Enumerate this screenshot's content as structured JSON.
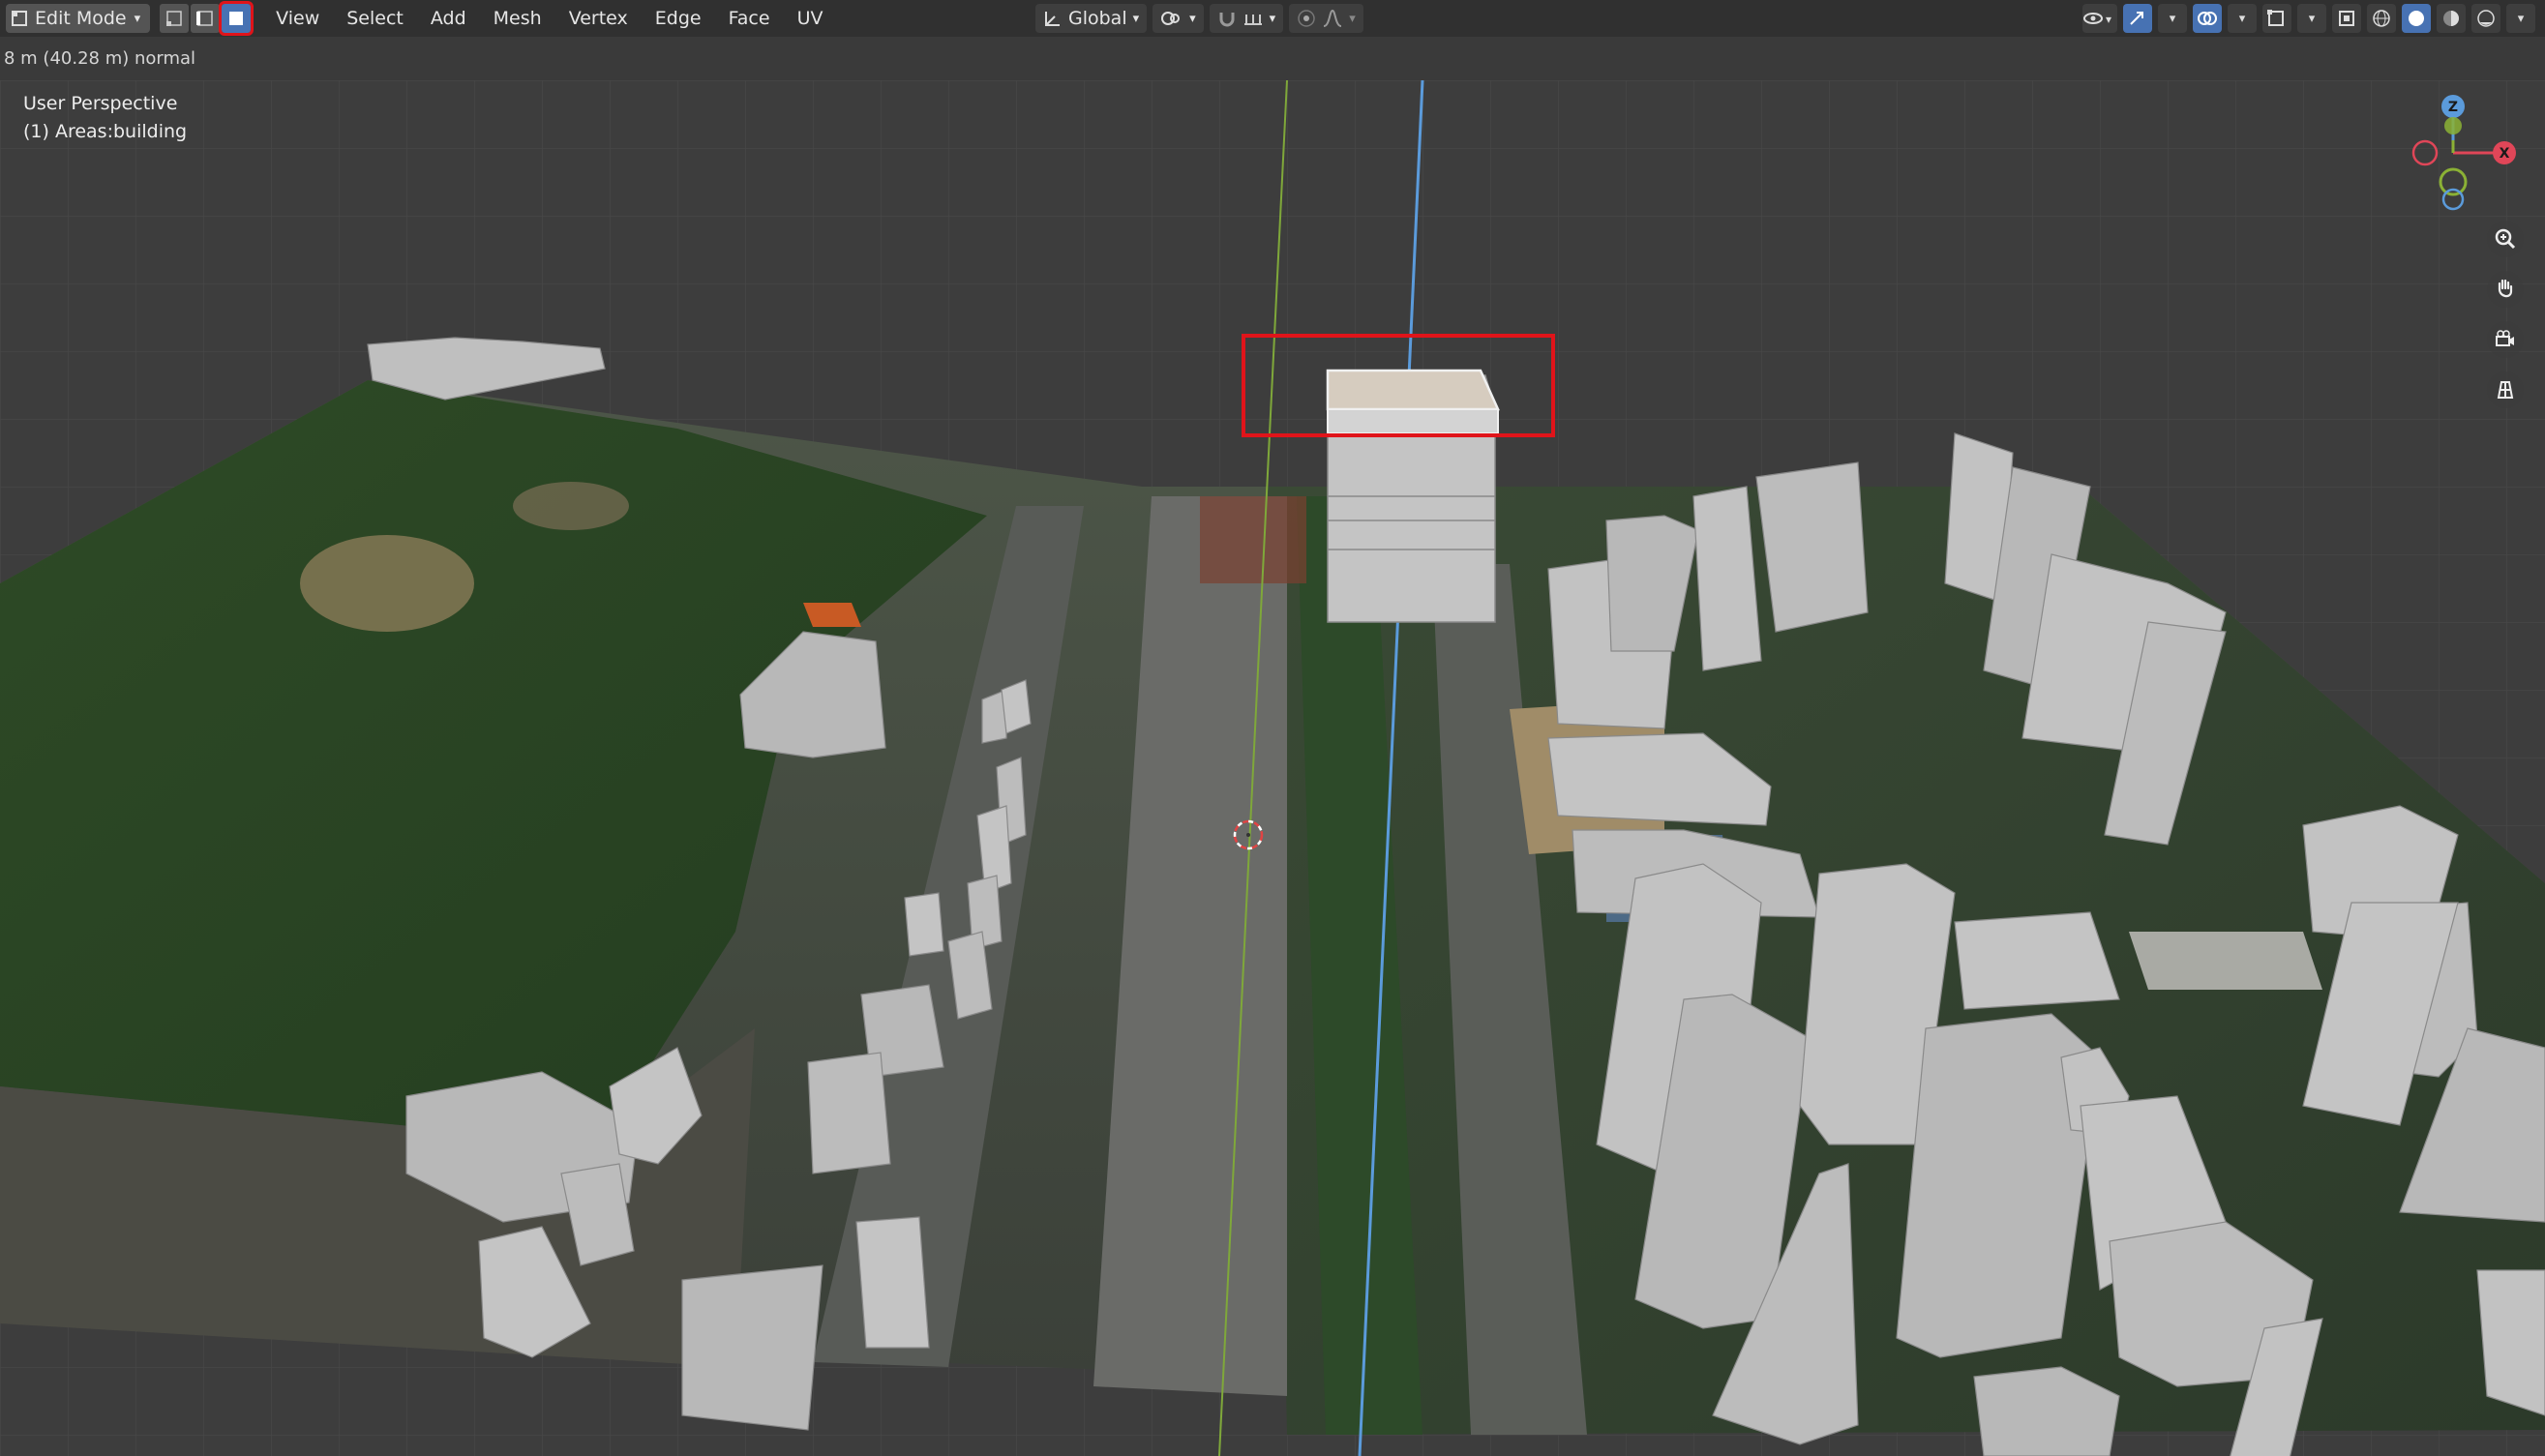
{
  "header": {
    "mode_label": "Edit Mode",
    "menu": [
      "View",
      "Select",
      "Add",
      "Mesh",
      "Vertex",
      "Edge",
      "Face",
      "UV"
    ],
    "orientation_label": "Global"
  },
  "status": {
    "text": "8 m (40.28 m) normal"
  },
  "viewport": {
    "perspective_label": "User Perspective",
    "object_label": "(1) Areas:building"
  },
  "gizmo": {
    "z": "Z",
    "x": "X"
  },
  "colors": {
    "highlight": "#e0141a",
    "z_axis": "#5b9bdb",
    "y_axis": "#8bb135",
    "x_axis": "#e04658"
  }
}
